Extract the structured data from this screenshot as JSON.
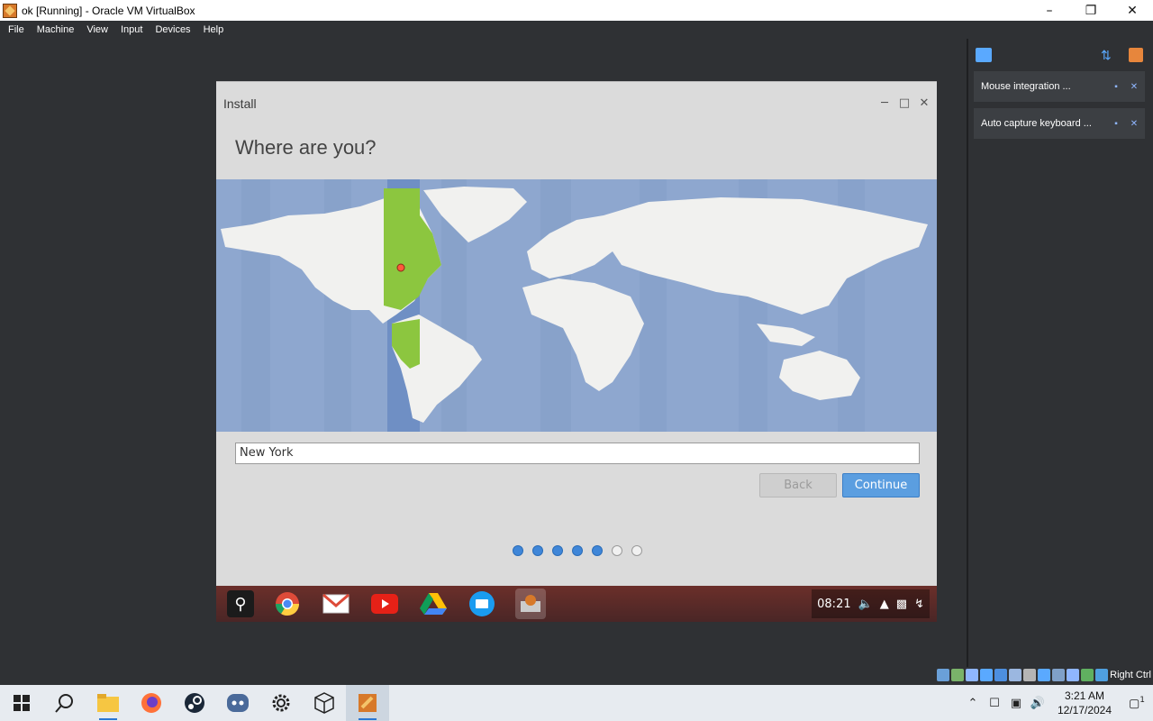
{
  "window": {
    "title": "ok [Running] - Oracle VM VirtualBox"
  },
  "menubar": {
    "items": [
      "File",
      "Machine",
      "View",
      "Input",
      "Devices",
      "Help"
    ]
  },
  "installer": {
    "title": "Install",
    "heading": "Where are you?",
    "location_value": "New York",
    "back_label": "Back",
    "continue_label": "Continue",
    "progress": {
      "completed_steps": 5,
      "total_steps": 7
    }
  },
  "guest_taskbar": {
    "apps": [
      "search-icon",
      "chrome-icon",
      "gmail-icon",
      "youtube-icon",
      "drive-icon",
      "files-icon",
      "installer-icon"
    ],
    "clock": "08:21"
  },
  "side_panel": {
    "notifications": [
      "Mouse integration ...",
      "Auto capture keyboard ..."
    ]
  },
  "statusbar": {
    "host_key": "Right Ctrl"
  },
  "win_taskbar": {
    "time": "3:21 AM",
    "date": "12/17/2024",
    "notification_count": "1"
  },
  "colors": {
    "accent": "#5b9ee0",
    "map_ocean": "#8ea7cf",
    "timezone_highlight": "#8cc63f"
  }
}
